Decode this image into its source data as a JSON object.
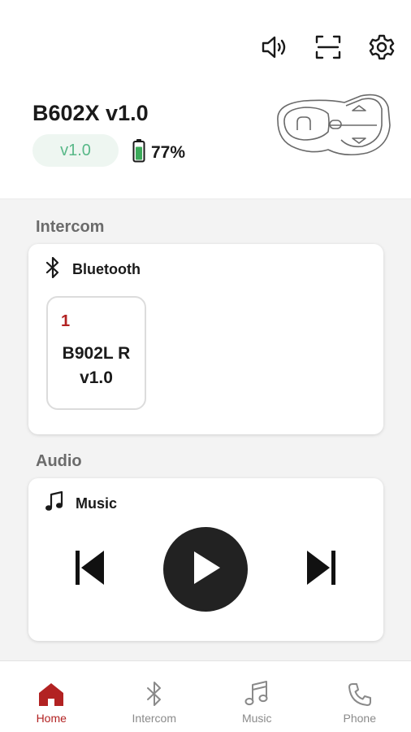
{
  "header": {
    "device_name": "B602X v1.0",
    "version_badge": "v1.0",
    "battery_percent": "77%",
    "battery_level": 0.77,
    "icons": [
      "speaker-volume-icon",
      "scan-icon",
      "settings-gear-icon"
    ]
  },
  "intercom": {
    "section_title": "Intercom",
    "card_label": "Bluetooth",
    "peer": {
      "index": "1",
      "name": "B902L R v1.0"
    }
  },
  "audio": {
    "section_title": "Audio",
    "card_label": "Music",
    "controls": [
      "previous-track-icon",
      "play-icon",
      "next-track-icon"
    ]
  },
  "nav": {
    "items": [
      {
        "label": "Home",
        "icon": "home-icon",
        "active": true
      },
      {
        "label": "Intercom",
        "icon": "bluetooth-icon",
        "active": false
      },
      {
        "label": "Music",
        "icon": "music-note-icon",
        "active": false
      },
      {
        "label": "Phone",
        "icon": "phone-icon",
        "active": false
      }
    ]
  },
  "colors": {
    "accent": "#b22222",
    "version_green": "#58b888",
    "battery_green": "#3caa5a",
    "play_button": "#222222"
  }
}
